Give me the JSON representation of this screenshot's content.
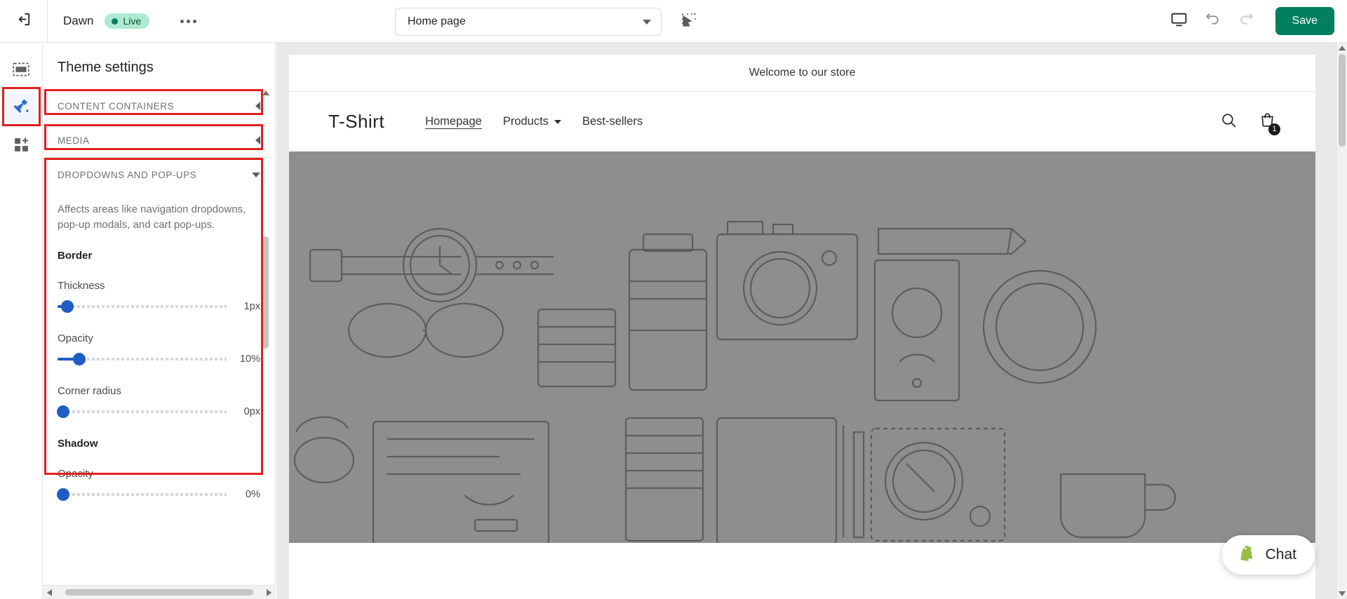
{
  "topbar": {
    "back_icon": "exit-left-icon",
    "theme_name": "Dawn",
    "status_badge": "Live",
    "more_menu": "more-options",
    "page_selector": {
      "value": "Home page",
      "caret": "chevron-down-icon"
    },
    "inspector_icon": "inspector-select-icon",
    "device_icon": "desktop-preview-icon",
    "undo_icon": "undo-icon",
    "redo_icon": "redo-icon",
    "save_label": "Save",
    "save_color": "#008060"
  },
  "rail": {
    "items": [
      {
        "name": "sidebar-item-sections",
        "icon": "sections-icon",
        "active": false
      },
      {
        "name": "sidebar-item-theme-settings",
        "icon": "paint-brush-icon",
        "active": true
      },
      {
        "name": "sidebar-item-apps",
        "icon": "apps-add-icon",
        "active": false
      }
    ],
    "highlight_color": "#e01f1f"
  },
  "panel": {
    "title": "Theme settings",
    "sections": [
      {
        "label": "CONTENT CONTAINERS",
        "expanded": false,
        "chevron": "chevron-left-icon",
        "highlighted": true
      },
      {
        "label": "MEDIA",
        "expanded": false,
        "chevron": "chevron-left-icon",
        "highlighted": true
      },
      {
        "label": "DROPDOWNS AND POP-UPS",
        "expanded": true,
        "chevron": "chevron-down-icon",
        "highlighted": true
      }
    ],
    "dropdowns_section": {
      "description": "Affects areas like navigation dropdowns, pop-up modals, and cart pop-ups.",
      "groups": [
        {
          "title": "Border",
          "fields": [
            {
              "label": "Thickness",
              "value": "1px",
              "percent": 6
            },
            {
              "label": "Opacity",
              "value": "10%",
              "percent": 13
            },
            {
              "label": "Corner radius",
              "value": "0px",
              "percent": 0
            }
          ]
        },
        {
          "title": "Shadow",
          "fields": [
            {
              "label": "Opacity",
              "value": "0%",
              "percent": 0
            }
          ]
        }
      ]
    }
  },
  "preview": {
    "announcement": "Welcome to our store",
    "store": {
      "logo": "T-Shirt",
      "nav": [
        {
          "label": "Homepage",
          "active": true,
          "caret": false
        },
        {
          "label": "Products",
          "active": false,
          "caret": true
        },
        {
          "label": "Best-sellers",
          "active": false,
          "caret": false
        }
      ],
      "search_icon": "search-icon",
      "cart_icon": "cart-icon",
      "cart_count": "1"
    },
    "hero": {
      "background_color": "#8e8e8e",
      "alt": "product-illustration"
    }
  },
  "chat": {
    "label": "Chat",
    "icon": "shopify-bag-icon"
  }
}
